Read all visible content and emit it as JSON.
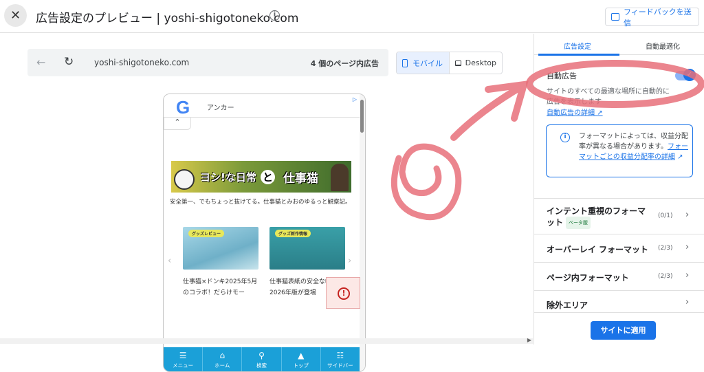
{
  "header": {
    "title": "広告設定のプレビュー | yoshi-shigotoneko.com",
    "feedback_label": "フィードバックを送信"
  },
  "preview": {
    "url": "yoshi-shigotoneko.com",
    "ad_count": "4 個のページ内広告",
    "device_mobile": "モバイル",
    "device_desktop": "Desktop",
    "device_selected": "モバイル"
  },
  "phone": {
    "anchor_label": "アンカー",
    "banner_text_1": "ヨシ!な日常",
    "banner_text_2": "と",
    "banner_text_3": "仕事猫",
    "site_description": "安全第一、でもちょっと抜けてる。仕事猫とみおのゆるっと観察記。",
    "cards": [
      {
        "tag": "グッズレビュー",
        "caption": "仕事猫×ドンキ2025年5月のコラボ！だらけモー"
      },
      {
        "tag": "グッズ新作情報",
        "caption": "仕事猫表紙の安全な帳2026年版が登場"
      }
    ],
    "nav": [
      {
        "icon": "menu-icon",
        "glyph": "☰",
        "label": "メニュー"
      },
      {
        "icon": "home-icon",
        "glyph": "⌂",
        "label": "ホーム"
      },
      {
        "icon": "search-icon",
        "glyph": "⚲",
        "label": "検索"
      },
      {
        "icon": "up-arrow-icon",
        "glyph": "▲",
        "label": "トップ"
      },
      {
        "icon": "sidebar-icon",
        "glyph": "☷",
        "label": "サイドバー"
      }
    ]
  },
  "settings": {
    "tab_ad_settings": "広告設定",
    "tab_auto_optimize": "自動最適化",
    "auto_ads_label": "自動広告",
    "auto_ads_enabled": true,
    "auto_ads_desc": "サイトのすべての最適な場所に自動的に広告を表示します",
    "auto_ads_link": "自動広告の詳細",
    "info_text": "フォーマットによっては、収益分配率が異なる場合があります。",
    "info_link": "フォーマットごとの収益分配率の詳細",
    "sections": [
      {
        "label": "インテント重視のフォーマット",
        "count": "(0/1)",
        "badge": "ベータ版"
      },
      {
        "label": "オーバーレイ フォーマット",
        "count": "(2/3)",
        "badge": ""
      },
      {
        "label": "ページ内フォーマット",
        "count": "(2/3)",
        "badge": ""
      },
      {
        "label": "除外エリア",
        "count": "",
        "badge": ""
      }
    ],
    "apply_label": "サイトに適用"
  },
  "colors": {
    "accent": "#1a73e8",
    "annotation": "#e8707a"
  }
}
